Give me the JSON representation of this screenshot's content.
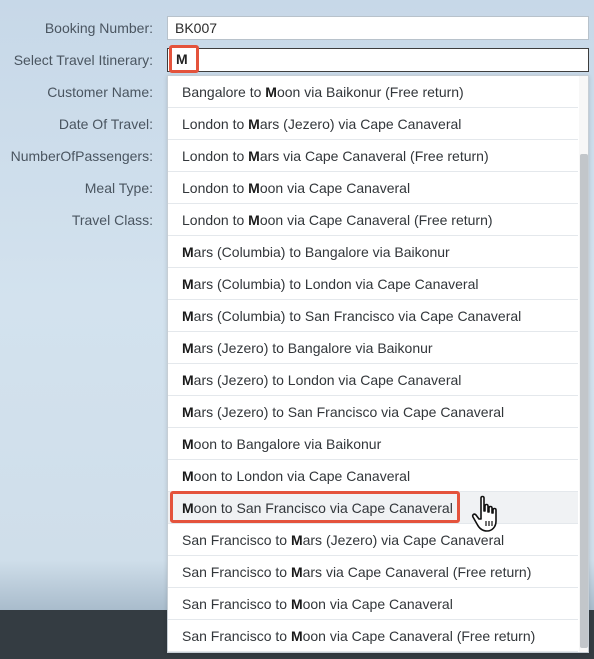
{
  "form": {
    "booking_number_label": "Booking Number:",
    "booking_number_value": "BK007",
    "itinerary_label": "Select Travel Itinerary:",
    "itinerary_typed": "M",
    "customer_name_label": "Customer Name:",
    "date_label": "Date Of Travel:",
    "passengers_label": "NumberOfPassengers:",
    "meal_label": "Meal Type:",
    "class_label": "Travel Class:"
  },
  "dropdown": {
    "items": [
      {
        "pre": "Bangalore to ",
        "m": "M",
        "post": "oon via Baikonur (Free return)"
      },
      {
        "pre": "London to ",
        "m": "M",
        "post": "ars (Jezero) via Cape Canaveral"
      },
      {
        "pre": "London to ",
        "m": "M",
        "post": "ars via Cape Canaveral (Free return)"
      },
      {
        "pre": "London to ",
        "m": "M",
        "post": "oon via Cape Canaveral"
      },
      {
        "pre": "London to ",
        "m": "M",
        "post": "oon via Cape Canaveral (Free return)"
      },
      {
        "pre": "",
        "m": "M",
        "post": "ars (Columbia) to Bangalore via Baikonur"
      },
      {
        "pre": "",
        "m": "M",
        "post": "ars (Columbia) to London via Cape Canaveral"
      },
      {
        "pre": "",
        "m": "M",
        "post": "ars (Columbia) to San Francisco via Cape Canaveral"
      },
      {
        "pre": "",
        "m": "M",
        "post": "ars (Jezero) to Bangalore via Baikonur"
      },
      {
        "pre": "",
        "m": "M",
        "post": "ars (Jezero) to London via Cape Canaveral"
      },
      {
        "pre": "",
        "m": "M",
        "post": "ars (Jezero) to San Francisco via Cape Canaveral"
      },
      {
        "pre": "",
        "m": "M",
        "post": "oon to Bangalore via Baikonur"
      },
      {
        "pre": "",
        "m": "M",
        "post": "oon to London via Cape Canaveral"
      },
      {
        "pre": "",
        "m": "M",
        "post": "oon to San Francisco via Cape Canaveral"
      },
      {
        "pre": "San Francisco to ",
        "m": "M",
        "post": "ars (Jezero) via Cape Canaveral"
      },
      {
        "pre": "San Francisco to ",
        "m": "M",
        "post": "ars via Cape Canaveral (Free return)"
      },
      {
        "pre": "San Francisco to ",
        "m": "M",
        "post": "oon via Cape Canaveral"
      },
      {
        "pre": "San Francisco to ",
        "m": "M",
        "post": "oon via Cape Canaveral (Free return)"
      }
    ],
    "hovered_index": 13
  },
  "colors": {
    "highlight": "#e4533c",
    "footer": "#343c42"
  },
  "icons": {
    "cursor": "hand-pointer-icon"
  }
}
